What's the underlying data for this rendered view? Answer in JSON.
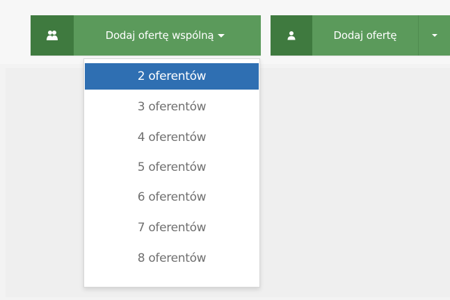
{
  "colors": {
    "primary_dark": "#3f7a3f",
    "primary": "#5b9a5b",
    "dropdown_active": "#2f6fb2",
    "text_muted": "#6f6f6f"
  },
  "toolbar": {
    "joint_offer": {
      "icon": "users-icon",
      "label": "Dodaj ofertę wspólną"
    },
    "single_offer": {
      "icon": "user-icon",
      "label": "Dodaj ofertę"
    }
  },
  "dropdown": {
    "items": [
      {
        "label": "2 oferentów",
        "active": true
      },
      {
        "label": "3 oferentów",
        "active": false
      },
      {
        "label": "4 oferentów",
        "active": false
      },
      {
        "label": "5 oferentów",
        "active": false
      },
      {
        "label": "6 oferentów",
        "active": false
      },
      {
        "label": "7 oferentów",
        "active": false
      },
      {
        "label": "8 oferentów",
        "active": false
      }
    ]
  }
}
